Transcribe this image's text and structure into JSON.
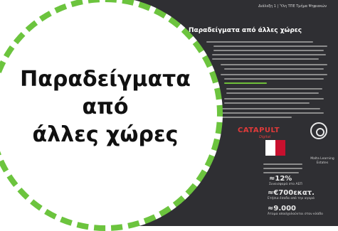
{
  "slide": {
    "header_text": "Διάλεξη 1 | Ύλη ΤΠΕ Τμήμα Ψηφιακών",
    "title": "Παραδείγματα από άλλες χώρες",
    "logo_text": "CATAPULT",
    "logo_subtext": "Digital",
    "emblem_caption": "Malta Learning Estates",
    "stats": [
      {
        "value": "≈12%",
        "label": "Συνεισφορά στο ΑΕΠ"
      },
      {
        "value": "≈€700εκατ.",
        "label": "Ετήσια έσοδα από την αγορά"
      },
      {
        "value": "≈9.000",
        "label": "Άτομα απασχολούνται στον κλάδο"
      }
    ]
  },
  "badge": {
    "title_lines": [
      "Παραδείγματα",
      "από",
      "άλλες χώρες"
    ]
  },
  "colors": {
    "badge_border": "#6cc43e",
    "slide_background": "#2f2f33",
    "logo": "#e03a3a"
  }
}
